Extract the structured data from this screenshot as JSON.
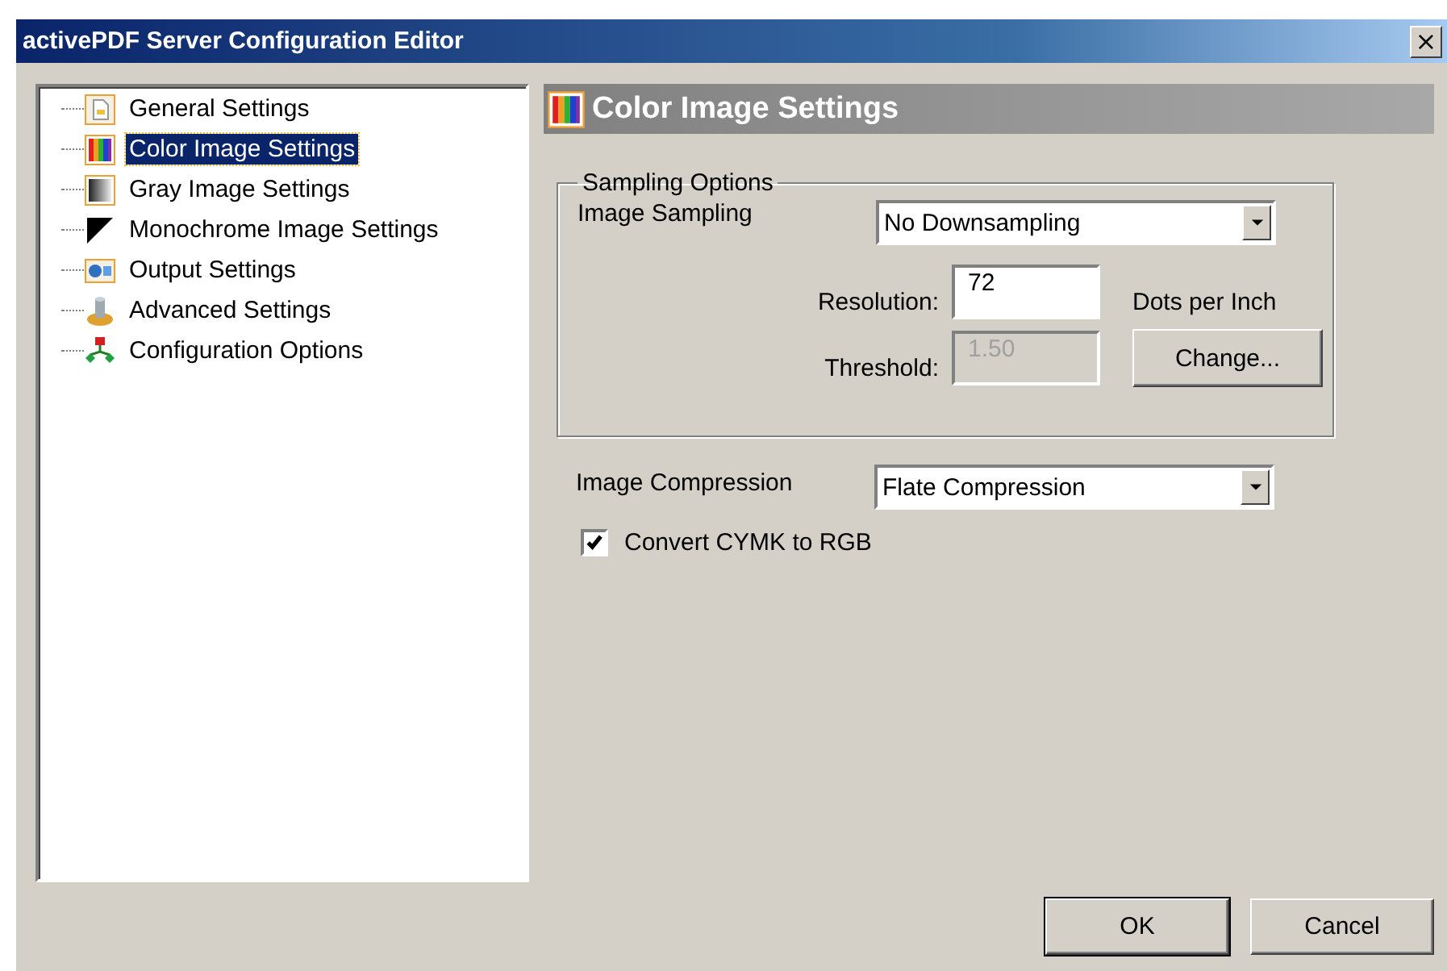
{
  "window": {
    "title": "activePDF Server Configuration Editor",
    "close": "×"
  },
  "tree": {
    "items": [
      {
        "label": "General Settings",
        "kind": "page",
        "selected": false
      },
      {
        "label": "Color Image Settings",
        "kind": "spectrum",
        "selected": true
      },
      {
        "label": "Gray Image Settings",
        "kind": "gradient",
        "selected": false
      },
      {
        "label": "Monochrome Image Settings",
        "kind": "mono",
        "selected": false
      },
      {
        "label": "Output Settings",
        "kind": "output",
        "selected": false
      },
      {
        "label": "Advanced Settings",
        "kind": "cylinder",
        "selected": false
      },
      {
        "label": "Configuration Options",
        "kind": "flow",
        "selected": false
      }
    ]
  },
  "panel": {
    "title": "Color Image Settings",
    "kind": "spectrum",
    "sampling": {
      "legend": "Sampling Options",
      "image_sampling_label": "Image Sampling",
      "image_sampling_value": "No Downsampling",
      "resolution_label": "Resolution:",
      "resolution_value": "72",
      "resolution_unit": "Dots per Inch",
      "threshold_label": "Threshold:",
      "threshold_value": "1.50",
      "threshold_disabled": true,
      "change_button": "Change..."
    },
    "compression_label": "Image Compression",
    "compression_value": "Flate Compression",
    "convert": {
      "label": "Convert CYMK to RGB",
      "checked": true
    }
  },
  "buttons": [
    "OK",
    "Cancel"
  ]
}
